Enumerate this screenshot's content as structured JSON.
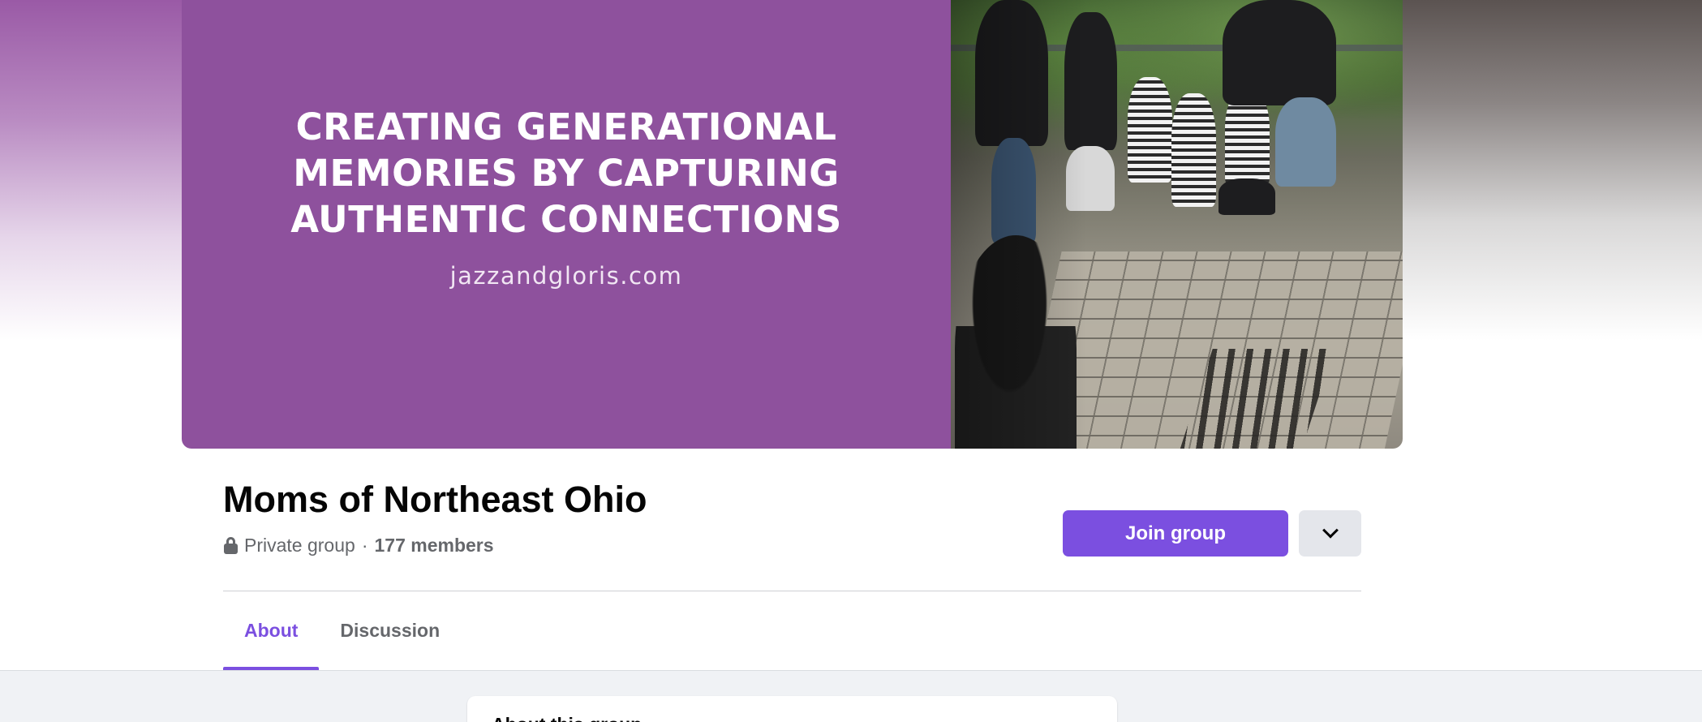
{
  "cover": {
    "headline_lines": [
      "CREATING GENERATIONAL",
      "MEMORIES BY CAPTURING",
      "AUTHENTIC CONNECTIONS"
    ],
    "url": "jazzandgloris.com",
    "brand_color": "#8e519d"
  },
  "group": {
    "name": "Moms of Northeast Ohio",
    "privacy": "Private group",
    "separator": "·",
    "members": "177 members"
  },
  "actions": {
    "join_label": "Join group",
    "accent_color": "#7b4fe0",
    "more_icon": "chevron-down-icon"
  },
  "tabs": [
    {
      "label": "About",
      "active": true
    },
    {
      "label": "Discussion",
      "active": false
    }
  ],
  "about_card": {
    "title": "About this group"
  }
}
